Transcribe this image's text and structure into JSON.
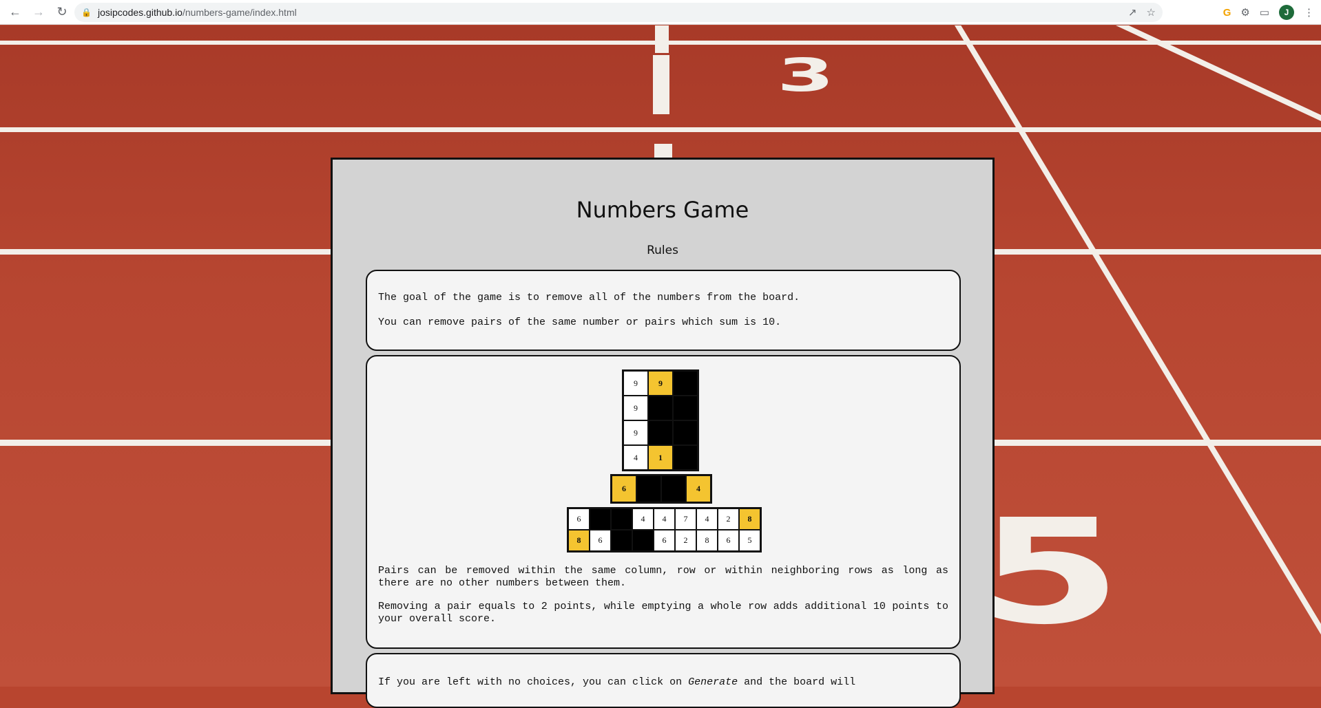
{
  "browser": {
    "url_host": "josipcodes.github.io",
    "url_path": "/numbers-game/index.html",
    "avatar_initial": "J"
  },
  "background": {
    "track_numbers": [
      "3",
      "5"
    ]
  },
  "page": {
    "title": "Numbers Game",
    "rules_heading": "Rules",
    "card1": {
      "p1": "The goal of the game is to remove all of the numbers from the board.",
      "p2": "You can remove pairs of the same number or pairs which sum is 10."
    },
    "card2": {
      "p1": "Pairs can be removed within the same column, row or within neighboring rows as long as there are no other numbers between them.",
      "p2": "Removing a pair equals to 2 points, while emptying a whole row adds additional 10 points to your overall score."
    },
    "card3": {
      "p1_start": "If you are left with no choices, you can click on ",
      "p1_em": "Generate",
      "p1_end": " and the board will"
    }
  },
  "examples": {
    "column_grid": [
      [
        {
          "v": "9",
          "s": "w"
        },
        {
          "v": "9",
          "s": "y"
        },
        {
          "v": "",
          "s": "b"
        }
      ],
      [
        {
          "v": "9",
          "s": "w"
        },
        {
          "v": "",
          "s": "b"
        },
        {
          "v": "",
          "s": "b"
        }
      ],
      [
        {
          "v": "9",
          "s": "w"
        },
        {
          "v": "",
          "s": "b"
        },
        {
          "v": "",
          "s": "b"
        }
      ],
      [
        {
          "v": "4",
          "s": "w"
        },
        {
          "v": "1",
          "s": "y"
        },
        {
          "v": "",
          "s": "b"
        }
      ]
    ],
    "row_grid": [
      [
        {
          "v": "6",
          "s": "y"
        },
        {
          "v": "",
          "s": "b"
        },
        {
          "v": "",
          "s": "b"
        },
        {
          "v": "4",
          "s": "y"
        }
      ]
    ],
    "neighbor_grid": [
      [
        {
          "v": "6",
          "s": "w"
        },
        {
          "v": "",
          "s": "b"
        },
        {
          "v": "",
          "s": "b"
        },
        {
          "v": "4",
          "s": "w"
        },
        {
          "v": "4",
          "s": "w"
        },
        {
          "v": "7",
          "s": "w"
        },
        {
          "v": "4",
          "s": "w"
        },
        {
          "v": "2",
          "s": "w"
        },
        {
          "v": "8",
          "s": "y"
        }
      ],
      [
        {
          "v": "8",
          "s": "y"
        },
        {
          "v": "6",
          "s": "w"
        },
        {
          "v": "",
          "s": "b"
        },
        {
          "v": "",
          "s": "b"
        },
        {
          "v": "6",
          "s": "w"
        },
        {
          "v": "2",
          "s": "w"
        },
        {
          "v": "8",
          "s": "w"
        },
        {
          "v": "6",
          "s": "w"
        },
        {
          "v": "5",
          "s": "w"
        }
      ]
    ]
  }
}
